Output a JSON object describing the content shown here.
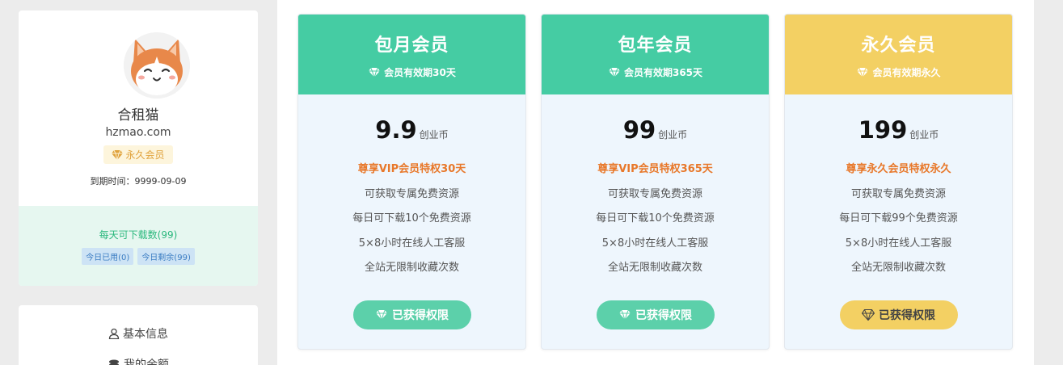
{
  "profile": {
    "name": "合租猫",
    "site": "hzmao.com",
    "vip_label": "永久会员",
    "expire": "到期时间：9999-09-09",
    "download_title": "每天可下载数(99)",
    "used_today": "今日已用(0)",
    "remaining_today": "今日剩余(99)"
  },
  "menu": {
    "items": [
      {
        "label": "基本信息",
        "icon": "user-icon"
      },
      {
        "label": "我的余额",
        "icon": "coins-icon"
      }
    ]
  },
  "colors": {
    "green": "#45cca3",
    "gold": "#f3d063",
    "highlight": "#e8782a"
  },
  "plans": [
    {
      "name": "包月会员",
      "period": "会员有效期30天",
      "price": "9.9",
      "unit": "创业币",
      "features": [
        "尊享VIP会员特权30天",
        "可获取专属免费资源",
        "每日可下载10个免费资源",
        "5×8小时在线人工客服",
        "全站无限制收藏次数"
      ],
      "button": "已获得权限",
      "theme": "green"
    },
    {
      "name": "包年会员",
      "period": "会员有效期365天",
      "price": "99",
      "unit": "创业币",
      "features": [
        "尊享VIP会员特权365天",
        "可获取专属免费资源",
        "每日可下载10个免费资源",
        "5×8小时在线人工客服",
        "全站无限制收藏次数"
      ],
      "button": "已获得权限",
      "theme": "green"
    },
    {
      "name": "永久会员",
      "period": "会员有效期永久",
      "price": "199",
      "unit": "创业币",
      "features": [
        "尊享永久会员特权永久",
        "可获取专属免费资源",
        "每日可下载99个免费资源",
        "5×8小时在线人工客服",
        "全站无限制收藏次数"
      ],
      "button": "已获得权限",
      "theme": "gold"
    }
  ]
}
